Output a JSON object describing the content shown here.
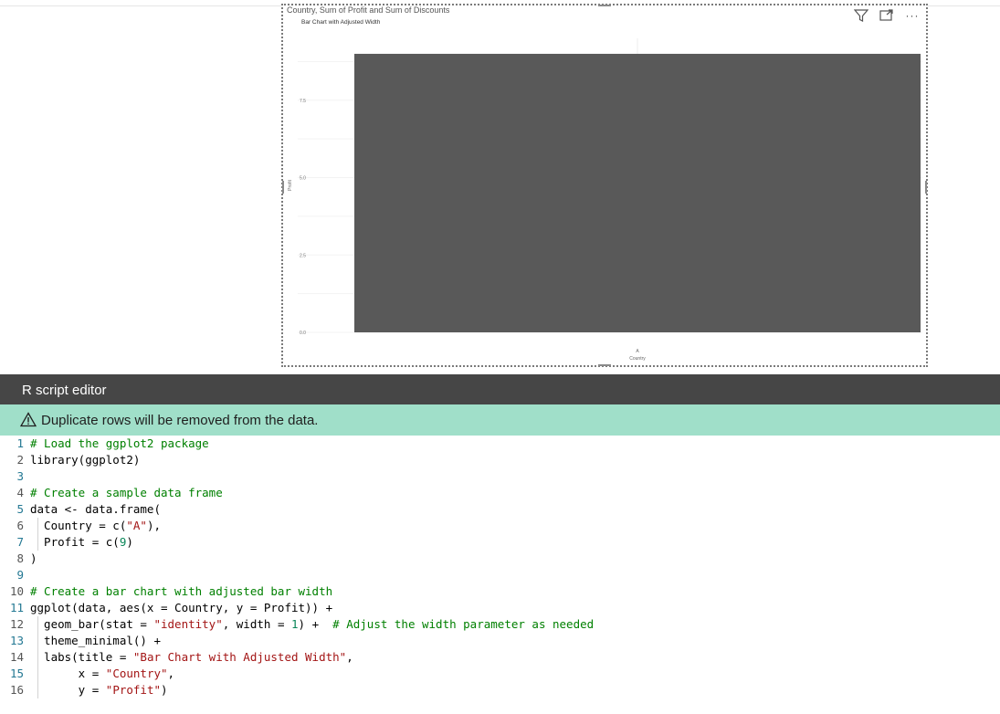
{
  "visual": {
    "title": "Country, Sum of Profit and Sum of Discounts",
    "icons": [
      "filter-icon",
      "focus-mode-icon",
      "more-options-icon"
    ]
  },
  "chart_data": {
    "type": "bar",
    "title": "Bar Chart with Adjusted Width",
    "xlabel": "Country",
    "ylabel": "Profit",
    "categories": [
      "A"
    ],
    "values": [
      9
    ],
    "ylim": [
      0,
      9.5
    ],
    "yticks": [
      0.0,
      2.5,
      5.0,
      7.5
    ],
    "ytick_labels": [
      "0.0",
      "2.5",
      "5.0",
      "7.5"
    ],
    "grid": true,
    "bar_color": "#595959"
  },
  "editor": {
    "title": "R script editor",
    "warning": "Duplicate rows will be removed from the data.",
    "lines": [
      {
        "n": "1",
        "code": "# Load the ggplot2 package"
      },
      {
        "n": "2",
        "code": "library(ggplot2)"
      },
      {
        "n": "3",
        "code": ""
      },
      {
        "n": "4",
        "code": "# Create a sample data frame"
      },
      {
        "n": "5",
        "code": "data <- data.frame("
      },
      {
        "n": "6",
        "code": "  Country = c(\"A\"),"
      },
      {
        "n": "7",
        "code": "  Profit = c(9)"
      },
      {
        "n": "8",
        "code": ")"
      },
      {
        "n": "9",
        "code": ""
      },
      {
        "n": "10",
        "code": "# Create a bar chart with adjusted bar width"
      },
      {
        "n": "11",
        "code": "ggplot(data, aes(x = Country, y = Profit)) +"
      },
      {
        "n": "12",
        "code": "  geom_bar(stat = \"identity\", width = 1) +  # Adjust the width parameter as needed"
      },
      {
        "n": "13",
        "code": "  theme_minimal() +"
      },
      {
        "n": "14",
        "code": "  labs(title = \"Bar Chart with Adjusted Width\","
      },
      {
        "n": "15",
        "code": "       x = \"Country\","
      },
      {
        "n": "16",
        "code": "       y = \"Profit\")"
      }
    ]
  },
  "colors": {
    "editor_header": "#464646",
    "warning_bg": "#a0dfc9",
    "comment": "#008000",
    "string": "#a31515",
    "number": "#098658"
  }
}
